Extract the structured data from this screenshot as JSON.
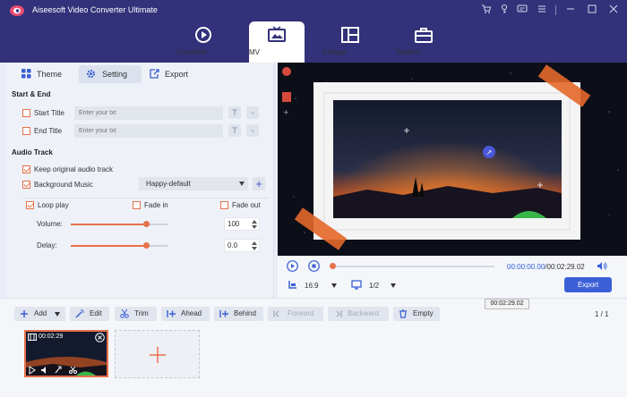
{
  "app": {
    "title": "Aiseesoft Video Converter Ultimate"
  },
  "tabs": [
    {
      "label": "Converter"
    },
    {
      "label": "MV"
    },
    {
      "label": "Collage"
    },
    {
      "label": "Toolbox"
    }
  ],
  "subtabs": {
    "theme": "Theme",
    "setting": "Setting",
    "export": "Export"
  },
  "start_end": {
    "title": "Start & End",
    "start_title_label": "Start Title",
    "start_title_placeholder": "Enter your txt",
    "end_title_label": "End Title",
    "end_title_placeholder": "Enter your txt"
  },
  "audio": {
    "title": "Audio Track",
    "keep_original": "Keep original audio track",
    "background_music": "Background Music",
    "music_selected": "Happy-default",
    "loop_play": "Loop play",
    "fade_in": "Fade in",
    "fade_out": "Fade out",
    "volume_label": "Volume:",
    "volume_value": "100",
    "volume_level": 0.78,
    "delay_label": "Delay:",
    "delay_value": "0.0",
    "delay_level": 0.78
  },
  "player": {
    "current_time": "00:00:00.00",
    "total_time": "/00:02:29.02",
    "aspect_ratio": "16:9",
    "page": "1/2",
    "export_label": "Export"
  },
  "toolbar": {
    "add": "Add",
    "edit": "Edit",
    "trim": "Trim",
    "ahead": "Ahead",
    "behind": "Behind",
    "forward": "Forward",
    "backward": "Backward",
    "empty": "Empty",
    "tooltip": "00:02:29.02",
    "page_indicator": "1 / 1"
  },
  "clip": {
    "duration": "00:02:29"
  },
  "colors": {
    "titlebar": "#32317a",
    "accent": "#e6724c",
    "primary": "#3b5fd6"
  }
}
